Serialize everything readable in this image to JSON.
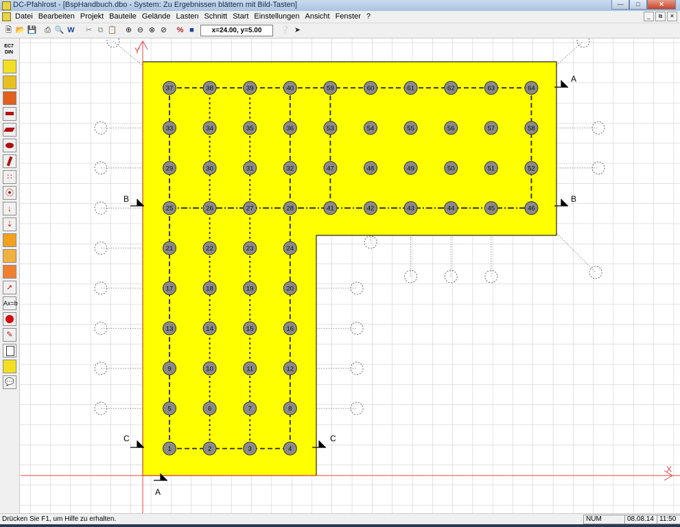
{
  "window": {
    "title": "DC-Pfahlrost - [BspHandbuch.dbo - System: Zu Ergebnissen blättern mit Bild-Tasten]"
  },
  "menu": [
    "Datei",
    "Bearbeiten",
    "Projekt",
    "Bauteile",
    "Gelände",
    "Lasten",
    "Schnitt",
    "Start",
    "Einstellungen",
    "Ansicht",
    "Fenster",
    "?"
  ],
  "toolbar": {
    "coordinates": "x=24.00, y=5.00"
  },
  "sidebar": {
    "norm_label": "EC7 DIN",
    "formula_label": "Ax=b"
  },
  "canvas": {
    "axis_x": "X",
    "axis_y": "Y",
    "section_labels": {
      "a": "A",
      "b": "B",
      "c": "C"
    },
    "piles": [
      {
        "n": "1",
        "c": 0,
        "r": 9
      },
      {
        "n": "2",
        "c": 1,
        "r": 9
      },
      {
        "n": "3",
        "c": 2,
        "r": 9
      },
      {
        "n": "4",
        "c": 3,
        "r": 9
      },
      {
        "n": "5",
        "c": 0,
        "r": 8
      },
      {
        "n": "6",
        "c": 1,
        "r": 8
      },
      {
        "n": "7",
        "c": 2,
        "r": 8
      },
      {
        "n": "8",
        "c": 3,
        "r": 8
      },
      {
        "n": "9",
        "c": 0,
        "r": 7
      },
      {
        "n": "10",
        "c": 1,
        "r": 7
      },
      {
        "n": "11",
        "c": 2,
        "r": 7
      },
      {
        "n": "12",
        "c": 3,
        "r": 7
      },
      {
        "n": "13",
        "c": 0,
        "r": 6
      },
      {
        "n": "14",
        "c": 1,
        "r": 6
      },
      {
        "n": "15",
        "c": 2,
        "r": 6
      },
      {
        "n": "16",
        "c": 3,
        "r": 6
      },
      {
        "n": "17",
        "c": 0,
        "r": 5
      },
      {
        "n": "18",
        "c": 1,
        "r": 5
      },
      {
        "n": "19",
        "c": 2,
        "r": 5
      },
      {
        "n": "20",
        "c": 3,
        "r": 5
      },
      {
        "n": "21",
        "c": 0,
        "r": 4
      },
      {
        "n": "22",
        "c": 1,
        "r": 4
      },
      {
        "n": "23",
        "c": 2,
        "r": 4
      },
      {
        "n": "24",
        "c": 3,
        "r": 4
      },
      {
        "n": "25",
        "c": 0,
        "r": 3
      },
      {
        "n": "26",
        "c": 1,
        "r": 3
      },
      {
        "n": "27",
        "c": 2,
        "r": 3
      },
      {
        "n": "28",
        "c": 3,
        "r": 3
      },
      {
        "n": "29",
        "c": 0,
        "r": 2
      },
      {
        "n": "30",
        "c": 1,
        "r": 2
      },
      {
        "n": "31",
        "c": 2,
        "r": 2
      },
      {
        "n": "32",
        "c": 3,
        "r": 2
      },
      {
        "n": "33",
        "c": 0,
        "r": 1
      },
      {
        "n": "34",
        "c": 1,
        "r": 1
      },
      {
        "n": "35",
        "c": 2,
        "r": 1
      },
      {
        "n": "36",
        "c": 3,
        "r": 1
      },
      {
        "n": "37",
        "c": 0,
        "r": 0
      },
      {
        "n": "38",
        "c": 1,
        "r": 0
      },
      {
        "n": "39",
        "c": 2,
        "r": 0
      },
      {
        "n": "40",
        "c": 3,
        "r": 0
      },
      {
        "n": "41",
        "c": 4,
        "r": 3
      },
      {
        "n": "42",
        "c": 5,
        "r": 3
      },
      {
        "n": "43",
        "c": 6,
        "r": 3
      },
      {
        "n": "44",
        "c": 7,
        "r": 3
      },
      {
        "n": "45",
        "c": 8,
        "r": 3
      },
      {
        "n": "46",
        "c": 9,
        "r": 3
      },
      {
        "n": "47",
        "c": 4,
        "r": 2
      },
      {
        "n": "48",
        "c": 5,
        "r": 2
      },
      {
        "n": "49",
        "c": 6,
        "r": 2
      },
      {
        "n": "50",
        "c": 7,
        "r": 2
      },
      {
        "n": "51",
        "c": 8,
        "r": 2
      },
      {
        "n": "52",
        "c": 9,
        "r": 2
      },
      {
        "n": "53",
        "c": 4,
        "r": 1
      },
      {
        "n": "54",
        "c": 5,
        "r": 1
      },
      {
        "n": "55",
        "c": 6,
        "r": 1
      },
      {
        "n": "56",
        "c": 7,
        "r": 1
      },
      {
        "n": "57",
        "c": 8,
        "r": 1
      },
      {
        "n": "58",
        "c": 9,
        "r": 1
      },
      {
        "n": "59",
        "c": 4,
        "r": 0
      },
      {
        "n": "60",
        "c": 5,
        "r": 0
      },
      {
        "n": "61",
        "c": 6,
        "r": 0
      },
      {
        "n": "62",
        "c": 7,
        "r": 0
      },
      {
        "n": "63",
        "c": 8,
        "r": 0
      },
      {
        "n": "64",
        "c": 9,
        "r": 0
      }
    ]
  },
  "status": {
    "message": "Drücken Sie F1, um Hilfe zu erhalten.",
    "num": "NUM",
    "date": "08.08.14",
    "time": "11:50"
  }
}
